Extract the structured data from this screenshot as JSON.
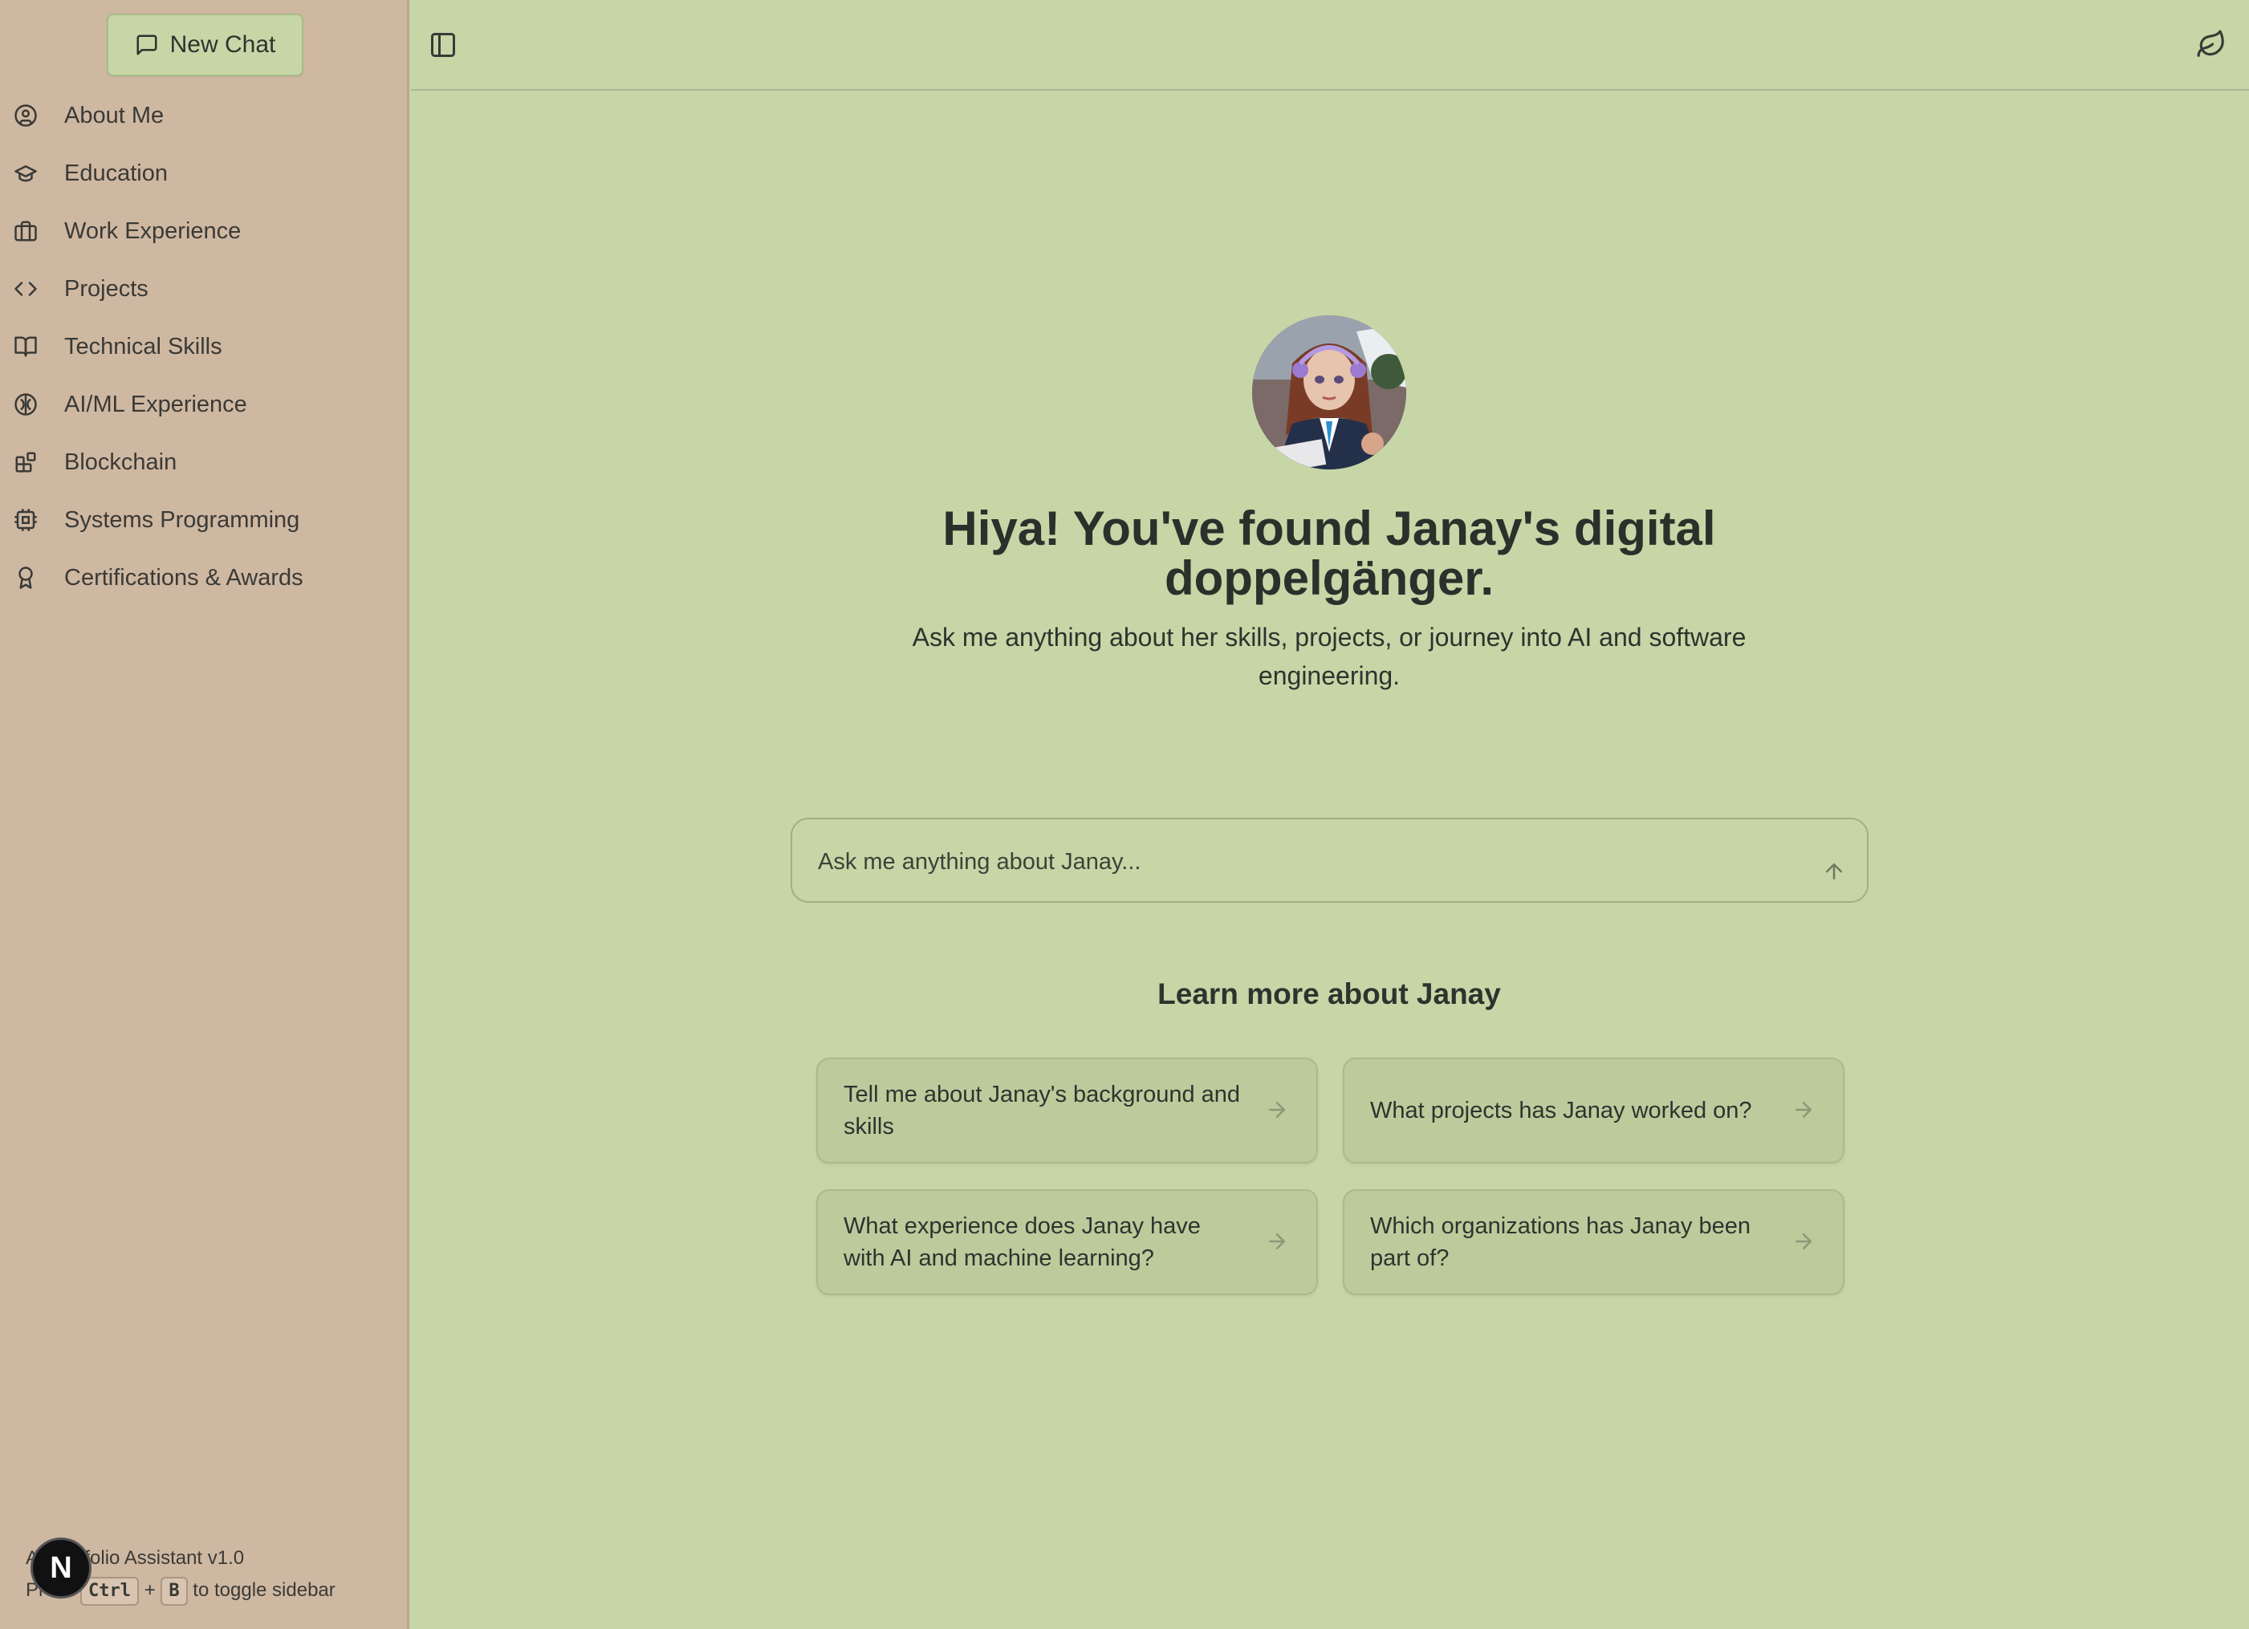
{
  "sidebar": {
    "new_chat_label": "New Chat",
    "items": [
      {
        "label": "About Me",
        "icon": "user-circle-icon"
      },
      {
        "label": "Education",
        "icon": "graduation-cap-icon"
      },
      {
        "label": "Work Experience",
        "icon": "briefcase-icon"
      },
      {
        "label": "Projects",
        "icon": "code-icon"
      },
      {
        "label": "Technical Skills",
        "icon": "book-open-icon"
      },
      {
        "label": "AI/ML Experience",
        "icon": "brain-icon"
      },
      {
        "label": "Blockchain",
        "icon": "blocks-icon"
      },
      {
        "label": "Systems Programming",
        "icon": "cpu-icon"
      },
      {
        "label": "Certifications & Awards",
        "icon": "award-icon"
      }
    ],
    "footer": {
      "version": "AI Portfolio Assistant v1.0",
      "press": "Press",
      "key1": "Ctrl",
      "plus": "+",
      "key2": "B",
      "hint": "to toggle sidebar"
    },
    "badge_letter": "N"
  },
  "header": {
    "toggle_icon": "sidebar-toggle-icon",
    "theme_icon": "leaf-icon"
  },
  "main": {
    "headline": "Hiya! You've found Janay's digital doppelgänger.",
    "subline": "Ask me anything about her skills, projects, or journey into AI and software engineering.",
    "input_placeholder": "Ask me anything about Janay...",
    "learn_title": "Learn more about Janay",
    "suggestions": [
      "Tell me about Janay's background and skills",
      "What projects has Janay worked on?",
      "What experience does Janay have with AI and machine learning?",
      "Which organizations has Janay been part of?"
    ]
  },
  "colors": {
    "main_bg": "#c7d6a7",
    "sidebar_bg": "#cfb8a2",
    "card_bg": "#bccb9c",
    "text": "#2e332e"
  }
}
